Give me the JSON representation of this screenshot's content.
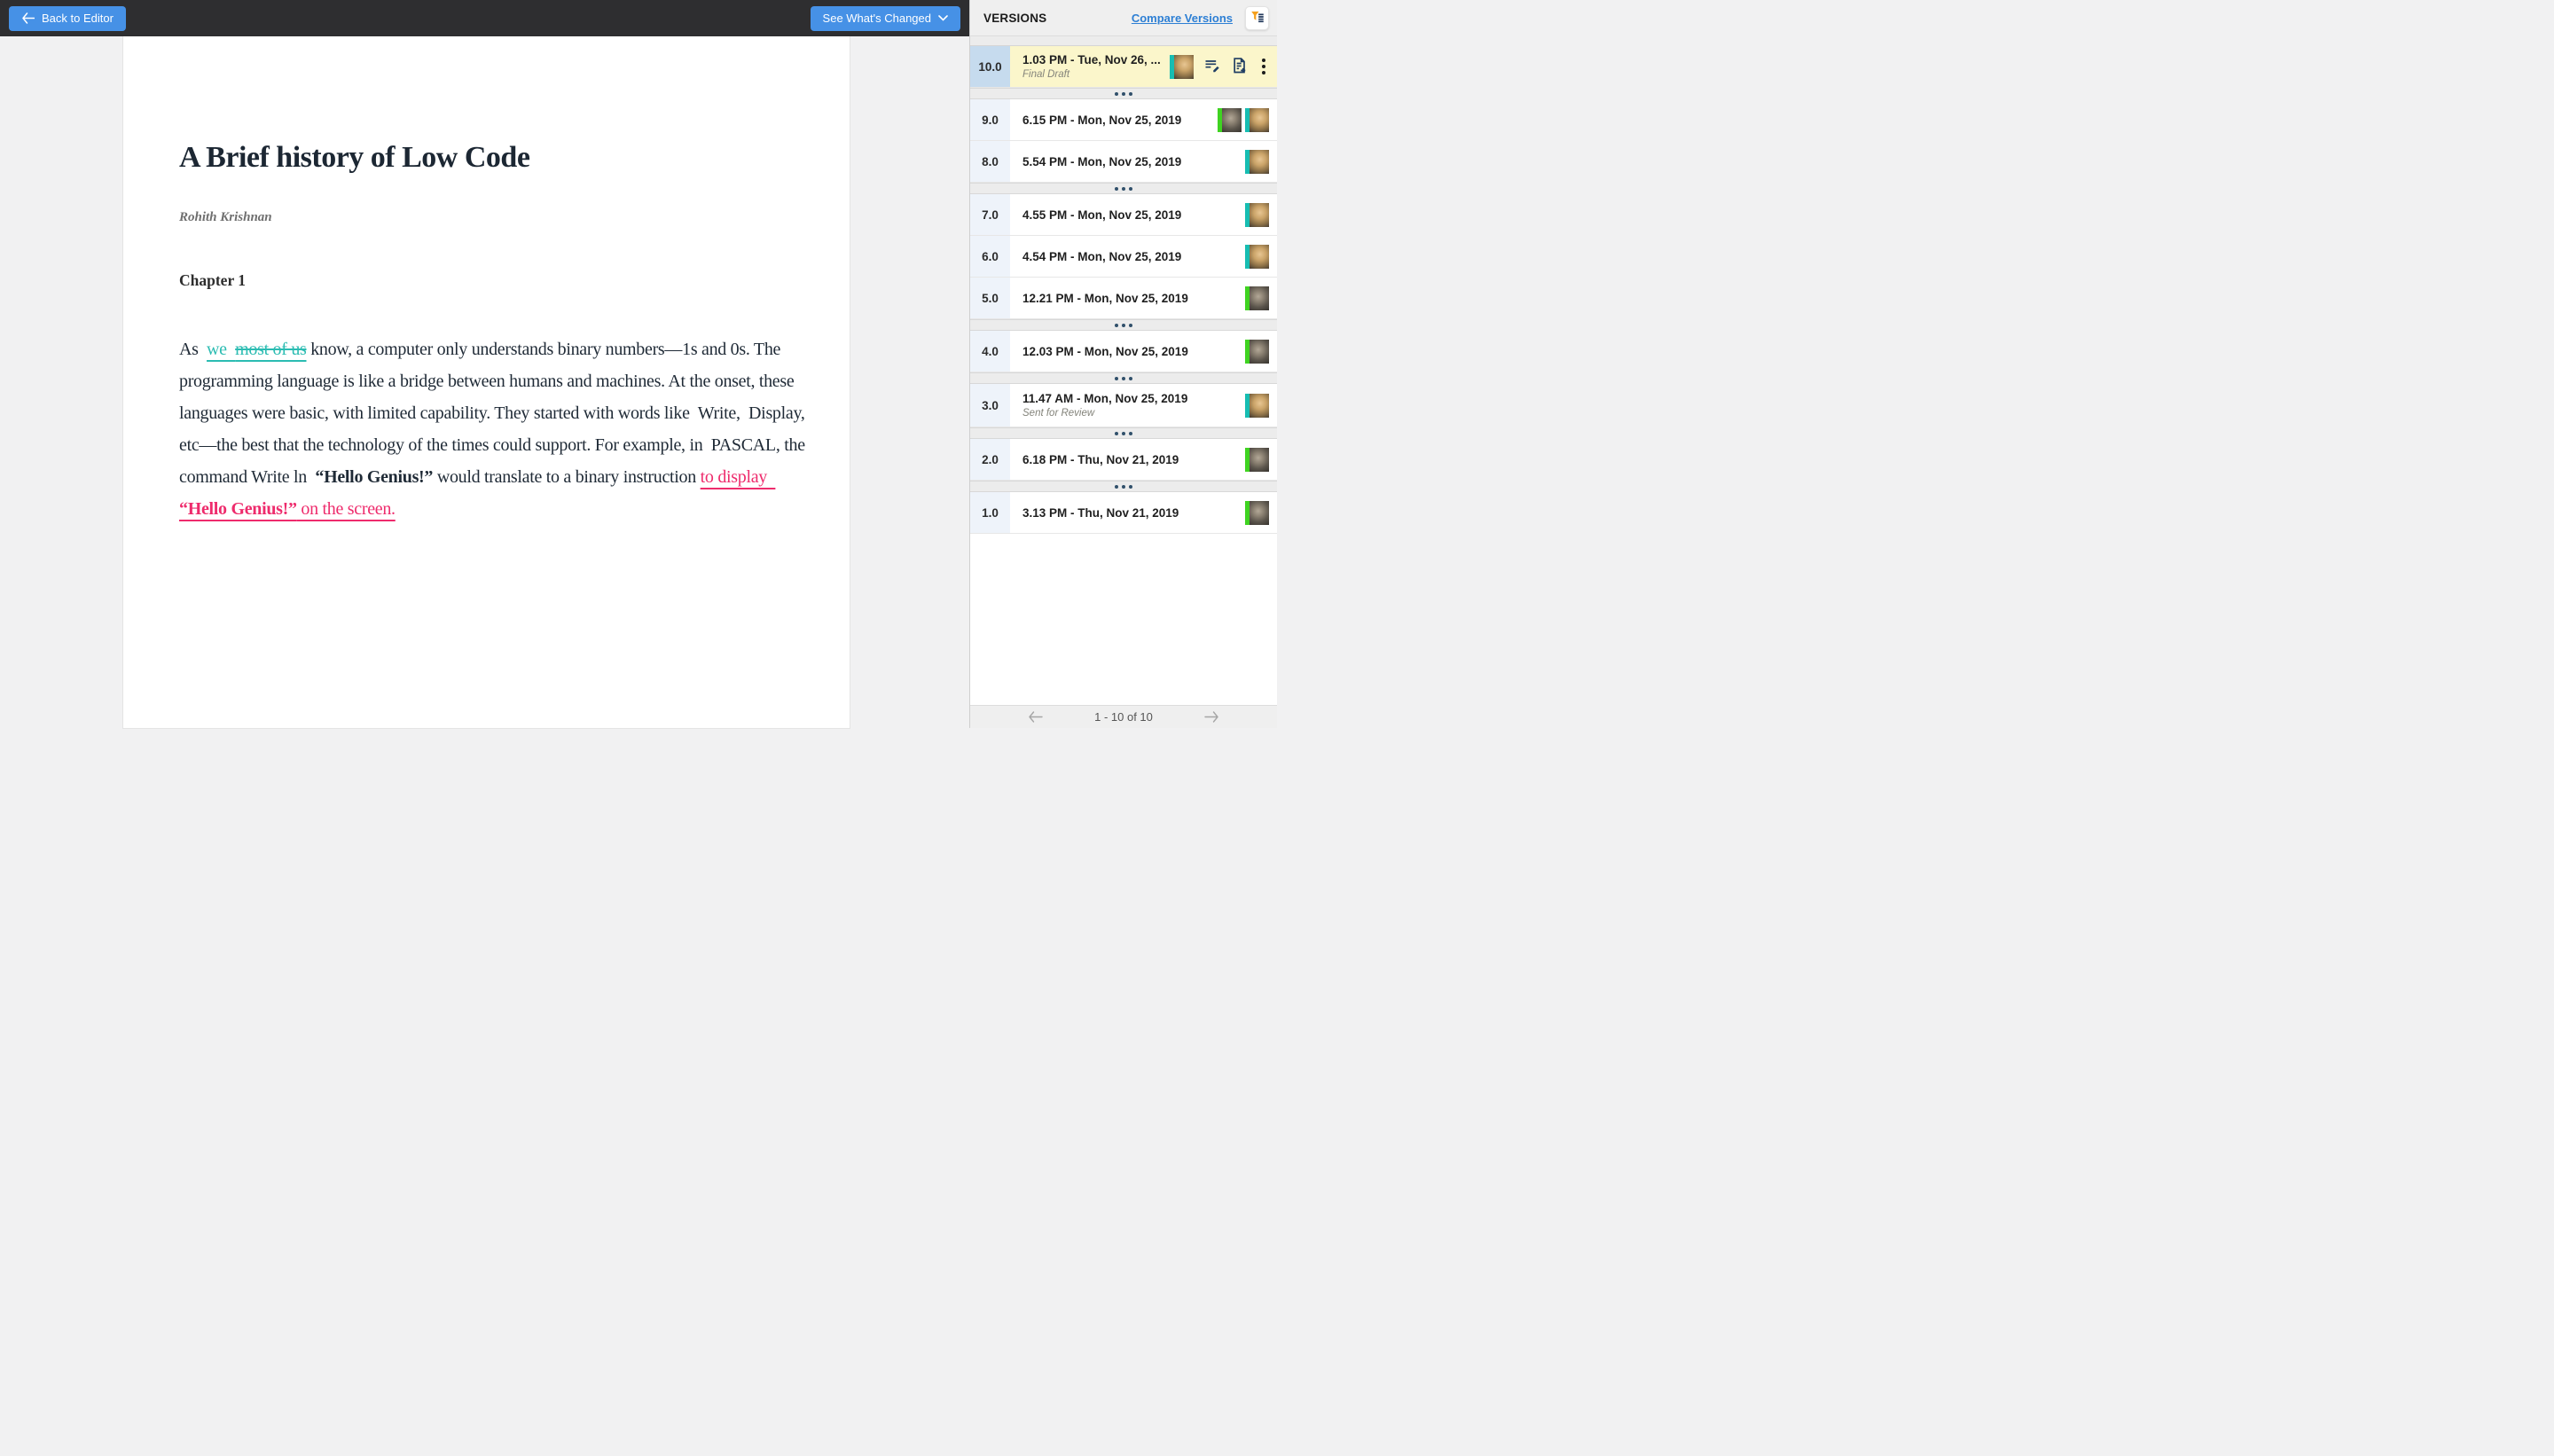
{
  "topbar": {
    "back_button": "Back to Editor",
    "whats_changed_button": "See What's Changed"
  },
  "versions_panel": {
    "title": "VERSIONS",
    "compare_versions_link": "Compare Versions",
    "filter_icon": "funnel-filter-icon",
    "rows": [
      {
        "version": "10.0",
        "timestamp": "1.03 PM - Tue, Nov 26, ...",
        "note": "Final Draft",
        "selected": true,
        "avatars": [
          "user-female"
        ],
        "actions": [
          "edit-version-notes-icon",
          "create-document-from-version-icon",
          "more-options-kebab"
        ]
      },
      {
        "version": "9.0",
        "timestamp": "6.15 PM - Mon, Nov 25, 2019",
        "avatars": [
          "user-male",
          "user-female"
        ]
      },
      {
        "version": "8.0",
        "timestamp": "5.54 PM - Mon, Nov 25, 2019",
        "avatars": [
          "user-female"
        ]
      },
      {
        "version": "7.0",
        "timestamp": "4.55 PM - Mon, Nov 25, 2019",
        "avatars": [
          "user-female"
        ]
      },
      {
        "version": "6.0",
        "timestamp": "4.54 PM - Mon, Nov 25, 2019",
        "avatars": [
          "user-female"
        ]
      },
      {
        "version": "5.0",
        "timestamp": "12.21 PM - Mon, Nov 25, 2019",
        "avatars": [
          "user-male"
        ]
      },
      {
        "version": "4.0",
        "timestamp": "12.03 PM - Mon, Nov 25, 2019",
        "avatars": [
          "user-male"
        ]
      },
      {
        "version": "3.0",
        "timestamp": "11.47 AM - Mon, Nov 25, 2019",
        "note": "Sent for Review",
        "avatars": [
          "user-female"
        ]
      },
      {
        "version": "2.0",
        "timestamp": "6.18 PM - Thu, Nov 21, 2019",
        "avatars": [
          "user-male"
        ]
      },
      {
        "version": "1.0",
        "timestamp": "3.13 PM - Thu, Nov 21, 2019",
        "avatars": [
          "user-male"
        ]
      }
    ],
    "pagination": {
      "range_label": "1 - 10 of 10"
    }
  },
  "document": {
    "title": "A Brief history of Low Code",
    "author": "Rohith Krishnan",
    "chapter_heading": "Chapter 1",
    "paragraph_runs": [
      {
        "style": "normal",
        "text": "As  "
      },
      {
        "style": "insertion-teal",
        "text": "we  "
      },
      {
        "style": "deletion-teal-strikethrough",
        "text": "most of us"
      },
      {
        "style": "normal",
        "text": " know, a computer only understands binary numbers—1s and 0s. The programming language is like a bridge between humans and machines. At the onset, these languages were basic, with limited capability. They started with words like  Write,  Display, etc—the best that the technology of the times could support. For example, in  PASCAL, the command Write ln  "
      },
      {
        "style": "bold",
        "text": "“Hello Genius!”"
      },
      {
        "style": "normal",
        "text": " would translate to a binary instruction "
      },
      {
        "style": "insertion-pink",
        "text": "to display  "
      },
      {
        "style": "insertion-pink-bold",
        "text": "“Hello Genius!”"
      },
      {
        "style": "insertion-pink",
        "text": " on the screen."
      }
    ]
  },
  "colors": {
    "topbar_bg": "#2e2e30",
    "accent_blue": "#4691e6",
    "link_blue": "#2d7fd4",
    "insertion_teal": "#2bbcb2",
    "insertion_pink": "#ee2b6c",
    "selected_row_yellow": "#fbf6cb",
    "selected_version_cell_blue": "#c6dbee"
  }
}
